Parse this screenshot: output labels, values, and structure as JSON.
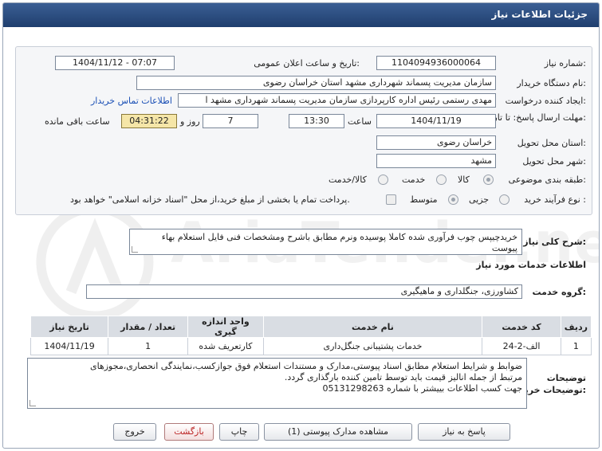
{
  "title": "جزئیات اطلاعات نیاز",
  "fields": {
    "need_number_label": "شماره نیاز:",
    "need_number": "1104094936000064",
    "announce_label": "تاریخ و ساعت اعلان عمومی:",
    "announce_value": "1404/11/12 - 07:07",
    "buyer_label": "نام دستگاه خریدار:",
    "buyer_value": "سازمان مدیریت پسماند شهرداری مشهد استان خراسان رضوی",
    "creator_label": "ایجاد کننده درخواست:",
    "creator_value": "مهدی رستمی رئیس اداره کارپردازی سازمان مدیریت پسماند شهرداری مشهد ا",
    "contact_link": "اطلاعات تماس خریدار",
    "deadline_label": "مهلت ارسال پاسخ: تا تاریخ:",
    "deadline_date": "1404/11/19",
    "time_label": "ساعت",
    "deadline_time": "13:30",
    "days_value": "7",
    "days_label": "روز و",
    "remaining_time": "04:31:22",
    "remaining_label": "ساعت باقی مانده",
    "province_label": "استان محل تحویل:",
    "province_value": "خراسان رضوی",
    "city_label": "شهر محل تحویل:",
    "city_value": "مشهد",
    "category_label": "طبقه بندی موضوعی:",
    "category_options": [
      "کالا",
      "خدمت",
      "کالا/خدمت"
    ],
    "process_label": "نوع فرآیند خرید :",
    "process_options": [
      "جزیی",
      "متوسط"
    ],
    "payment_note": "پرداخت تمام یا بخشی از مبلغ خرید،از محل \"اسناد خزانه اسلامی\" خواهد بود."
  },
  "description": {
    "label": "شرح کلی نیاز:",
    "value": "خریدچیپس چوب فرآوری شده کاملا پوسیده ونرم مطابق باشرح ومشخصات فنی فایل استعلام بهاء پیوست"
  },
  "services": {
    "section_title": "اطلاعات خدمات مورد نیاز",
    "group_label": "گروه خدمت:",
    "group_value": "کشاورزی، جنگلداری و ماهیگیری",
    "columns": [
      "ردیف",
      "کد خدمت",
      "نام خدمت",
      "واحد اندازه گیری",
      "تعداد / مقدار",
      "تاریخ نیاز"
    ],
    "rows": [
      [
        "1",
        "الف-2-24",
        "خدمات پشتیبانی جنگل‌داری",
        "کارتعریف شده",
        "1",
        "1404/11/19"
      ]
    ]
  },
  "buyer_notes": {
    "label": "توضیحات خریدار:",
    "lines": [
      "ضوابط و شرایط استعلام مطابق اسناد پیوستی،مدارک و مستندات استعلام فوق جوازکسب،نمایندگی انحصاری،مجوزهای",
      "مرتبط از جمله انالیز قیمت باید توسط تامین کننده بارگذاری گردد.",
      "جهت کسب اطلاعات بییشتر با شماره 05131298263"
    ]
  },
  "buttons": {
    "reply": "پاسخ به نیاز",
    "attachments": "مشاهده مدارک پیوستی (1)",
    "print": "چاپ",
    "back": "بازگشت",
    "exit": "خروج"
  },
  "watermark": "AriaTender.net"
}
